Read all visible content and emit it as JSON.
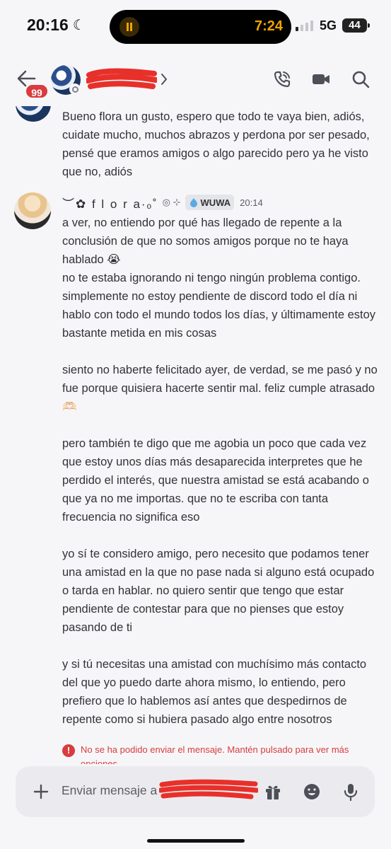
{
  "status_bar": {
    "time": "20:16",
    "live_activity_time": "7:24",
    "network": "5G",
    "battery": "44"
  },
  "header": {
    "unread_badge": "99",
    "icons": [
      "back-arrow-icon",
      "phone-call-icon",
      "video-camera-icon",
      "search-icon"
    ]
  },
  "messages": {
    "previous_message": "Bueno flora un gusto, espero que todo te vaya bien, adiós, cuidate mucho, muchos abrazos y perdona por ser pesado, pensé que eramos amigos o algo parecido pero ya he visto que no, adiós",
    "author": {
      "name": "︶✿ f l o r a·ₒ˚",
      "deco": "◎ ⊹",
      "tag": "WUWA",
      "time": "20:14"
    },
    "paragraphs": [
      "a ver, no entiendo por qué has llegado de repente a la conclusión de que no somos amigos porque no te haya hablado 😭\nno te estaba ignorando ni tengo ningún problema contigo. simplemente no estoy pendiente de discord todo el día ni hablo con todo el mundo todos los días, y últimamente estoy bastante metida en mis cosas",
      "siento no haberte felicitado ayer, de verdad, se me pasó y no fue porque quisiera hacerte sentir mal. feliz cumple atrasado 🫶🏻",
      "pero también te digo que me agobia un poco que cada vez que estoy unos días más desaparecida interpretes que he perdido el interés, que nuestra amistad se está acabando o que ya no me importas. que no te escriba con tanta frecuencia no significa eso",
      "yo sí te considero amigo, pero necesito que podamos tener una amistad en la que no pase nada si alguno está ocupado o tarda en hablar. no quiero sentir que tengo que estar pendiente de contestar para que no pienses que estoy pasando de ti",
      "y si tú necesitas una amistad con muchísimo más contacto del que yo puedo darte ahora mismo, lo entiendo, pero prefiero que lo hablemos así antes que despedirnos de repente como si hubiera pasado algo entre nosotros"
    ],
    "error": "No se ha podido enviar el mensaje. Mantén pulsado para ver más opciones"
  },
  "composer": {
    "placeholder": "Enviar mensaje a",
    "icons": [
      "plus-icon",
      "gift-icon",
      "emoji-icon",
      "microphone-icon"
    ]
  },
  "colors": {
    "error": "#d83c3e",
    "background": "#f6f6f8",
    "composer": "#ebebef",
    "redaction": "#e8302a"
  }
}
